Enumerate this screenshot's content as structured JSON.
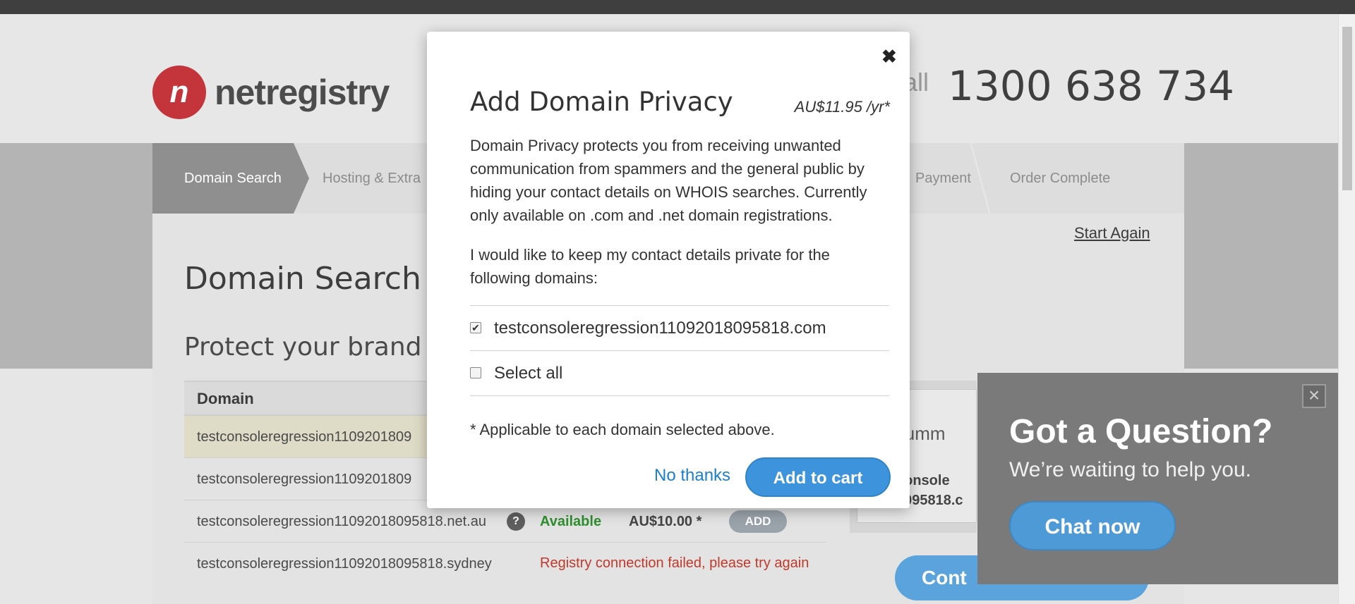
{
  "header": {
    "logo_text": "netregistry",
    "call_label": "all",
    "phone": "1300 638 734"
  },
  "steps": [
    {
      "label": "Domain Search"
    },
    {
      "label": "Hosting & Extra"
    },
    {
      "label": "Payment"
    },
    {
      "label": "Order Complete"
    }
  ],
  "page": {
    "start_again": "Start Again",
    "title": "Domain Search",
    "subtitle": "Protect your brand",
    "table_header": "Domain",
    "rows": [
      {
        "domain": "testconsoleregression1109201809"
      },
      {
        "domain": "testconsoleregression1109201809"
      },
      {
        "domain": "testconsoleregression11092018095818.net.au",
        "status": "Available",
        "price": "AU$10.00 *",
        "add": "ADD"
      },
      {
        "domain": "testconsoleregression11092018095818.sydney",
        "error": "Registry connection failed, please try again"
      }
    ]
  },
  "cart": {
    "summary": "t Summ",
    "domain_line1": "console",
    "domain_line2": "1095818.c",
    "continue": "Cont"
  },
  "chat": {
    "title": "Got a Question?",
    "subtitle": "We’re waiting to help you.",
    "button": "Chat now"
  },
  "modal": {
    "title": "Add Domain Privacy",
    "price": "AU$11.95 /yr*",
    "description": "Domain Privacy protects you from receiving unwanted communication from spammers and the general public by hiding your contact details on WHOIS searches. Currently only available on .com and .net domain registrations.",
    "prompt": "I would like to keep my contact details private for the following domains:",
    "items": [
      {
        "label": "testconsoleregression11092018095818.com",
        "checked": true
      },
      {
        "label": "Select all",
        "checked": false
      }
    ],
    "note": "* Applicable to each domain selected above.",
    "no_thanks": "No thanks",
    "add_to_cart": "Add to cart"
  }
}
